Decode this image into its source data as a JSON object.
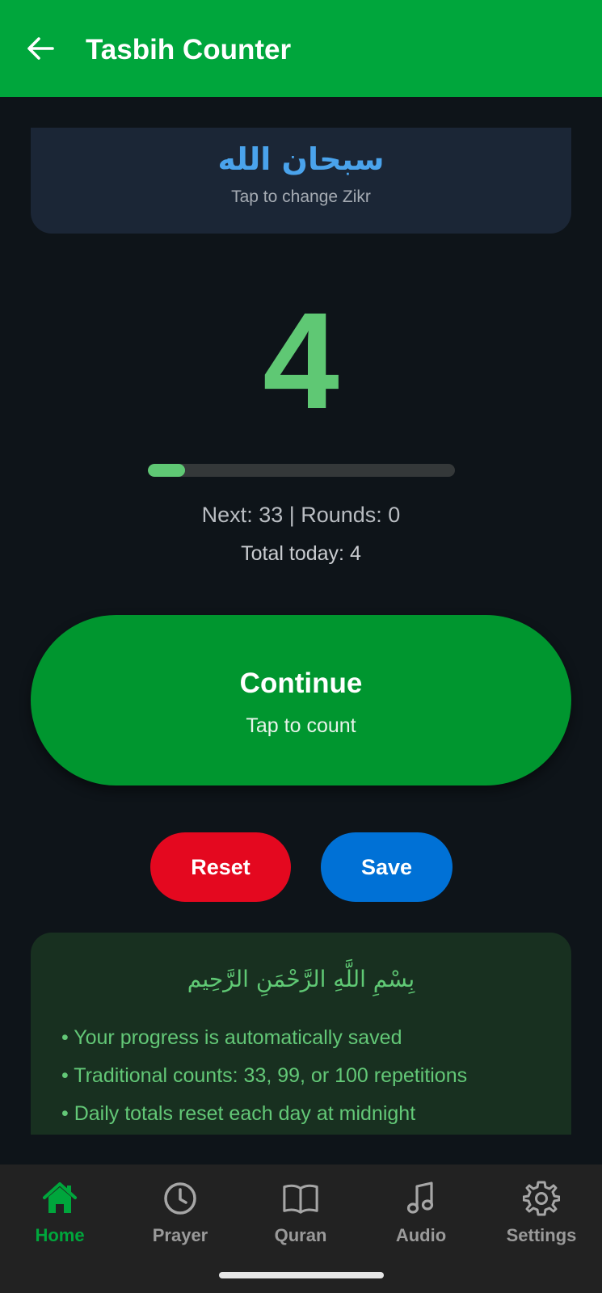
{
  "app_bar": {
    "title": "Tasbih Counter",
    "back_icon": "arrow-left-icon",
    "color": "#00a63c"
  },
  "zikr": {
    "arabic": "سبحان الله",
    "hint": "Tap to change Zikr"
  },
  "counter": {
    "count": "4",
    "progress": 0.12,
    "next_text": "Next: 33 | Rounds: 0",
    "total_text": "Total today: 4"
  },
  "continue_button": {
    "label": "Continue",
    "sub_label": "Tap to count"
  },
  "actions": {
    "reset_label": "Reset",
    "save_label": "Save",
    "reset_color": "#e4081f",
    "save_color": "#0071d6"
  },
  "info_card": {
    "arabic": "بِسْمِ اللَّهِ الرَّحْمَنِ الرَّحِيم",
    "items": [
      "• Your progress is automatically saved",
      "• Traditional counts: 33, 99, or 100 repetitions",
      "• Daily totals reset each day at midnight"
    ]
  },
  "bottom_nav": {
    "items": [
      {
        "label": "Home",
        "icon": "home-icon",
        "active": true
      },
      {
        "label": "Prayer",
        "icon": "clock-icon",
        "active": false
      },
      {
        "label": "Quran",
        "icon": "book-icon",
        "active": false
      },
      {
        "label": "Audio",
        "icon": "music-note-icon",
        "active": false
      },
      {
        "label": "Settings",
        "icon": "gear-icon",
        "active": false
      }
    ]
  }
}
